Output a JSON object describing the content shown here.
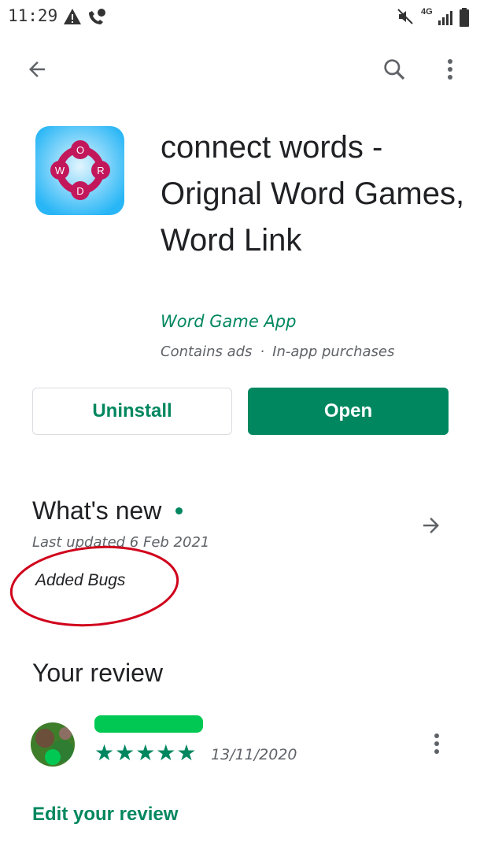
{
  "status_bar": {
    "time": "11:29",
    "network": "4G",
    "icons": [
      "warning-icon",
      "call-icon",
      "mute-icon",
      "signal-icon"
    ]
  },
  "toolbar": {
    "back_icon": "back-arrow-icon",
    "search_icon": "search-icon",
    "menu_icon": "more-vert-icon"
  },
  "app": {
    "title": "connect words - Orignal Word Games, Word Link",
    "developer": "Word Game App",
    "ads_label": "Contains ads",
    "separator": "·",
    "purchases_label": "In-app purchases",
    "icon_letters": [
      "O",
      "W",
      "R",
      "D"
    ],
    "colors": {
      "accent": "#01875f",
      "icon_bg": "#4fc3f7",
      "icon_nodes": "#c2185b"
    }
  },
  "actions": {
    "uninstall_label": "Uninstall",
    "open_label": "Open"
  },
  "whats_new": {
    "title": "What's new",
    "updated": "Last updated 6 Feb 2021",
    "notes": "Added Bugs",
    "annotation_color": "#d0021b"
  },
  "review": {
    "section_title": "Your review",
    "rating": 5,
    "stars": "★★★★★",
    "date": "13/11/2020",
    "edit_label": "Edit your review"
  }
}
